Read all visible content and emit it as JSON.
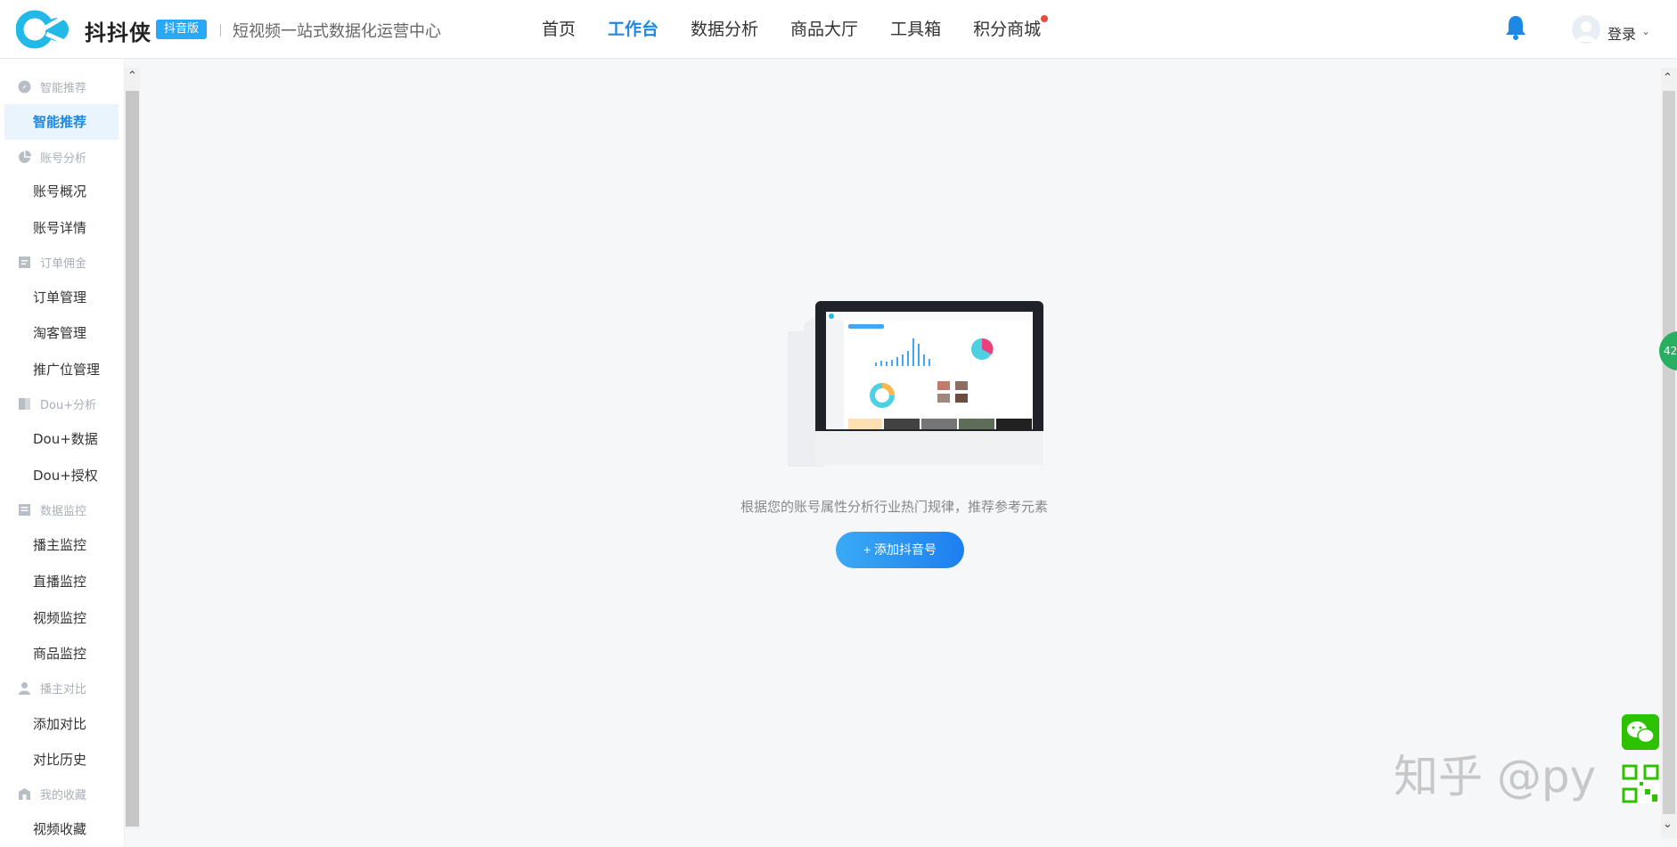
{
  "header": {
    "brand_name": "抖抖侠",
    "badge": "抖音版",
    "slogan": "短视频一站式数据化运营中心",
    "login_label": "登录",
    "nav": [
      {
        "label": "首页"
      },
      {
        "label": "工作台"
      },
      {
        "label": "数据分析"
      },
      {
        "label": "商品大厅"
      },
      {
        "label": "工具箱"
      },
      {
        "label": "积分商城"
      }
    ]
  },
  "sidebar": {
    "sections": [
      {
        "title": "智能推荐",
        "items": [
          "智能推荐"
        ]
      },
      {
        "title": "账号分析",
        "items": [
          "账号概况",
          "账号详情"
        ]
      },
      {
        "title": "订单佣金",
        "items": [
          "订单管理",
          "淘客管理",
          "推广位管理"
        ]
      },
      {
        "title": "Dou+分析",
        "items": [
          "Dou+数据",
          "Dou+授权"
        ]
      },
      {
        "title": "数据监控",
        "items": [
          "播主监控",
          "直播监控",
          "视频监控",
          "商品监控"
        ]
      },
      {
        "title": "播主对比",
        "items": [
          "添加对比",
          "对比历史"
        ]
      },
      {
        "title": "我的收藏",
        "items": [
          "视频收藏"
        ]
      }
    ]
  },
  "main": {
    "empty_text": "根据您的账号属性分析行业热门规律，推荐参考元素",
    "add_button": "+ 添加抖音号"
  },
  "float_badge": "42",
  "watermark": "知乎 @py",
  "colors": {
    "accent": "#1e88e5",
    "badge": "#29a8f5",
    "active_bg": "#eaf4fd"
  }
}
